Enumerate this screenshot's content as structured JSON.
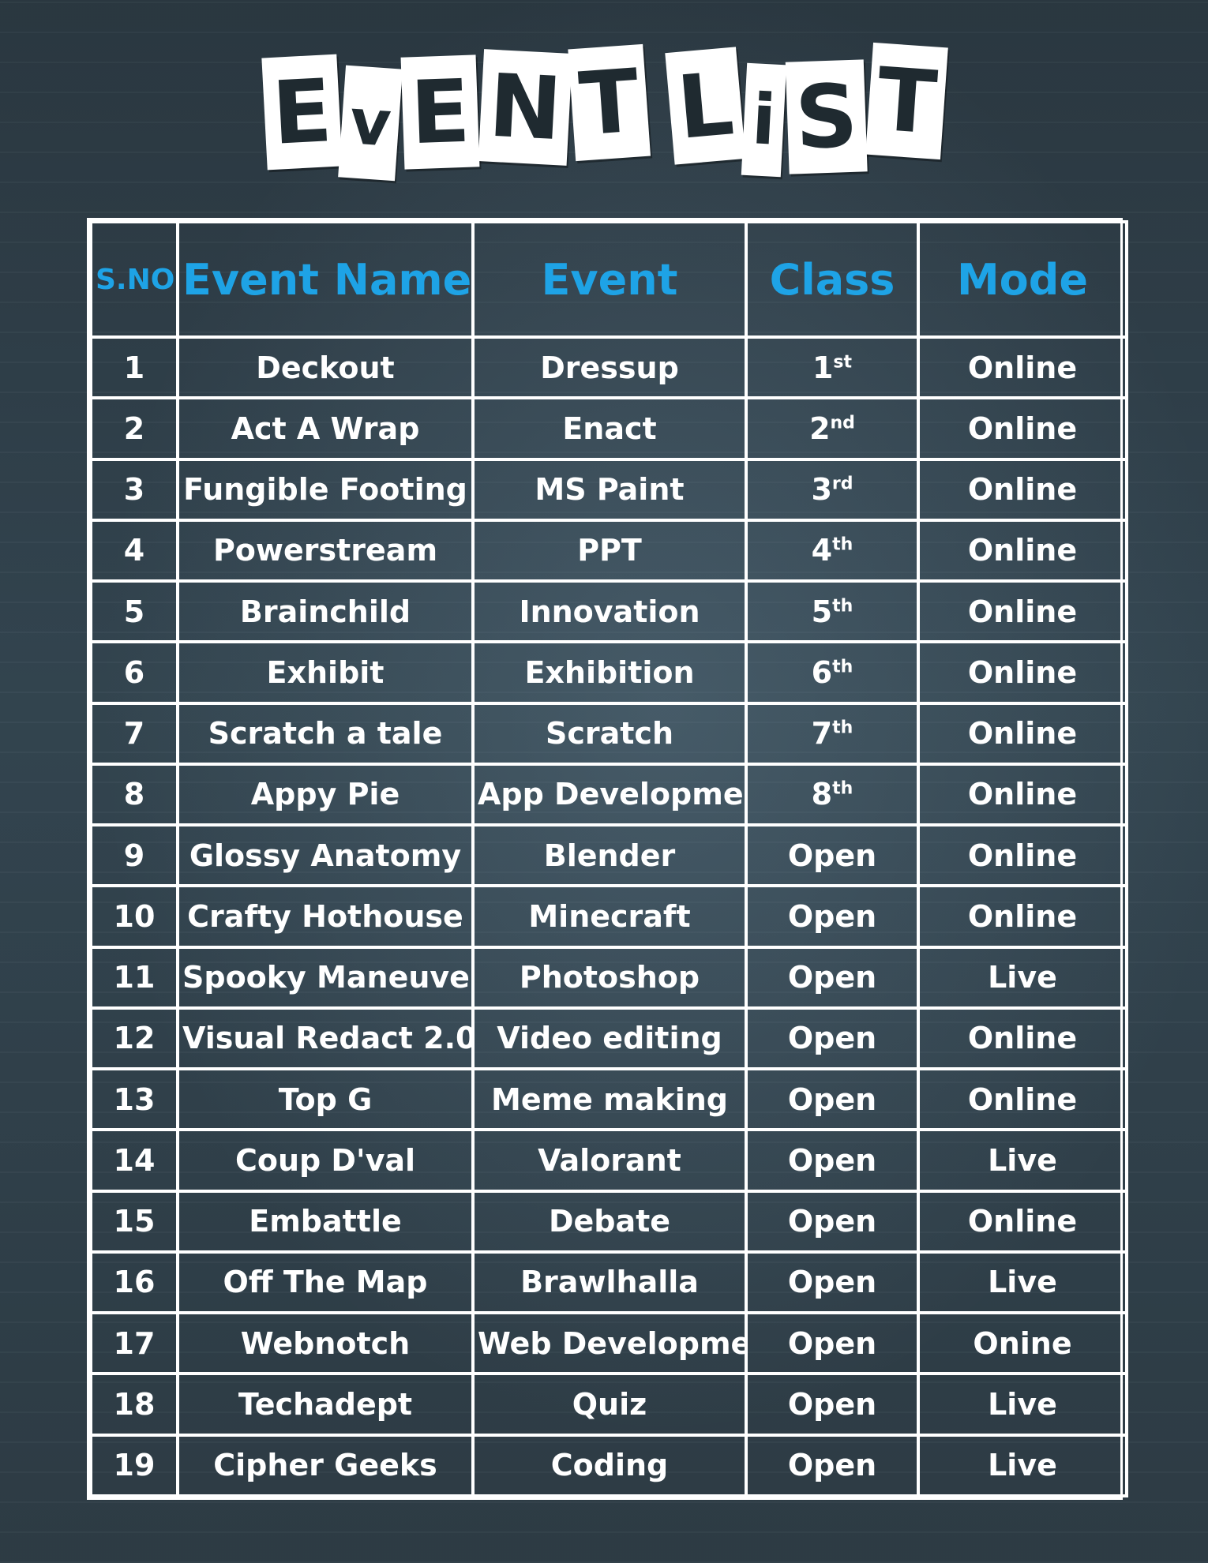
{
  "title": {
    "word1": [
      "E",
      "v",
      "E",
      "N",
      "T"
    ],
    "word2": [
      "L",
      "i",
      "S",
      "T"
    ]
  },
  "headers": {
    "sno": "S.NO",
    "event_name": "Event Name",
    "event": "Event",
    "class": "Class",
    "mode": "Mode"
  },
  "rows": [
    {
      "sno": "1",
      "event_name": "Deckout",
      "event": "Dressup",
      "class": "1",
      "class_sup": "st",
      "mode": "Online"
    },
    {
      "sno": "2",
      "event_name": "Act A Wrap",
      "event": "Enact",
      "class": "2",
      "class_sup": "nd",
      "mode": "Online"
    },
    {
      "sno": "3",
      "event_name": "Fungible Footing",
      "event": "MS Paint",
      "class": "3",
      "class_sup": "rd",
      "mode": "Online"
    },
    {
      "sno": "4",
      "event_name": "Powerstream",
      "event": "PPT",
      "class": "4",
      "class_sup": "th",
      "mode": "Online"
    },
    {
      "sno": "5",
      "event_name": "Brainchild",
      "event": "Innovation",
      "class": "5",
      "class_sup": "th",
      "mode": "Online"
    },
    {
      "sno": "6",
      "event_name": "Exhibit",
      "event": "Exhibition",
      "class": "6",
      "class_sup": "th",
      "mode": "Online"
    },
    {
      "sno": "7",
      "event_name": "Scratch a tale",
      "event": "Scratch",
      "class": "7",
      "class_sup": "th",
      "mode": "Online"
    },
    {
      "sno": "8",
      "event_name": "Appy Pie",
      "event": "App Development",
      "class": "8",
      "class_sup": "th",
      "mode": "Online"
    },
    {
      "sno": "9",
      "event_name": "Glossy Anatomy",
      "event": "Blender",
      "class": "Open",
      "class_sup": "",
      "mode": "Online"
    },
    {
      "sno": "10",
      "event_name": "Crafty Hothouse",
      "event": "Minecraft",
      "class": "Open",
      "class_sup": "",
      "mode": "Online"
    },
    {
      "sno": "11",
      "event_name": "Spooky Maneuvers",
      "event": "Photoshop",
      "class": "Open",
      "class_sup": "",
      "mode": "Live"
    },
    {
      "sno": "12",
      "event_name": "Visual Redact 2.0",
      "event": "Video editing",
      "class": "Open",
      "class_sup": "",
      "mode": "Online"
    },
    {
      "sno": "13",
      "event_name": "Top G",
      "event": "Meme making",
      "class": "Open",
      "class_sup": "",
      "mode": "Online"
    },
    {
      "sno": "14",
      "event_name": "Coup D'val",
      "event": "Valorant",
      "class": "Open",
      "class_sup": "",
      "mode": "Live"
    },
    {
      "sno": "15",
      "event_name": "Embattle",
      "event": "Debate",
      "class": "Open",
      "class_sup": "",
      "mode": "Online"
    },
    {
      "sno": "16",
      "event_name": "Off The Map",
      "event": "Brawlhalla",
      "class": "Open",
      "class_sup": "",
      "mode": "Live"
    },
    {
      "sno": "17",
      "event_name": "Webnotch",
      "event": "Web Development",
      "class": "Open",
      "class_sup": "",
      "mode": "Onine"
    },
    {
      "sno": "18",
      "event_name": "Techadept",
      "event": "Quiz",
      "class": "Open",
      "class_sup": "",
      "mode": "Live"
    },
    {
      "sno": "19",
      "event_name": "Cipher Geeks",
      "event": "Coding",
      "class": "Open",
      "class_sup": "",
      "mode": "Live"
    }
  ],
  "colors": {
    "header_text": "#1ea3e6",
    "cell_text": "#ffffff",
    "grid_lines": "#ffffff",
    "background": "#334550"
  }
}
